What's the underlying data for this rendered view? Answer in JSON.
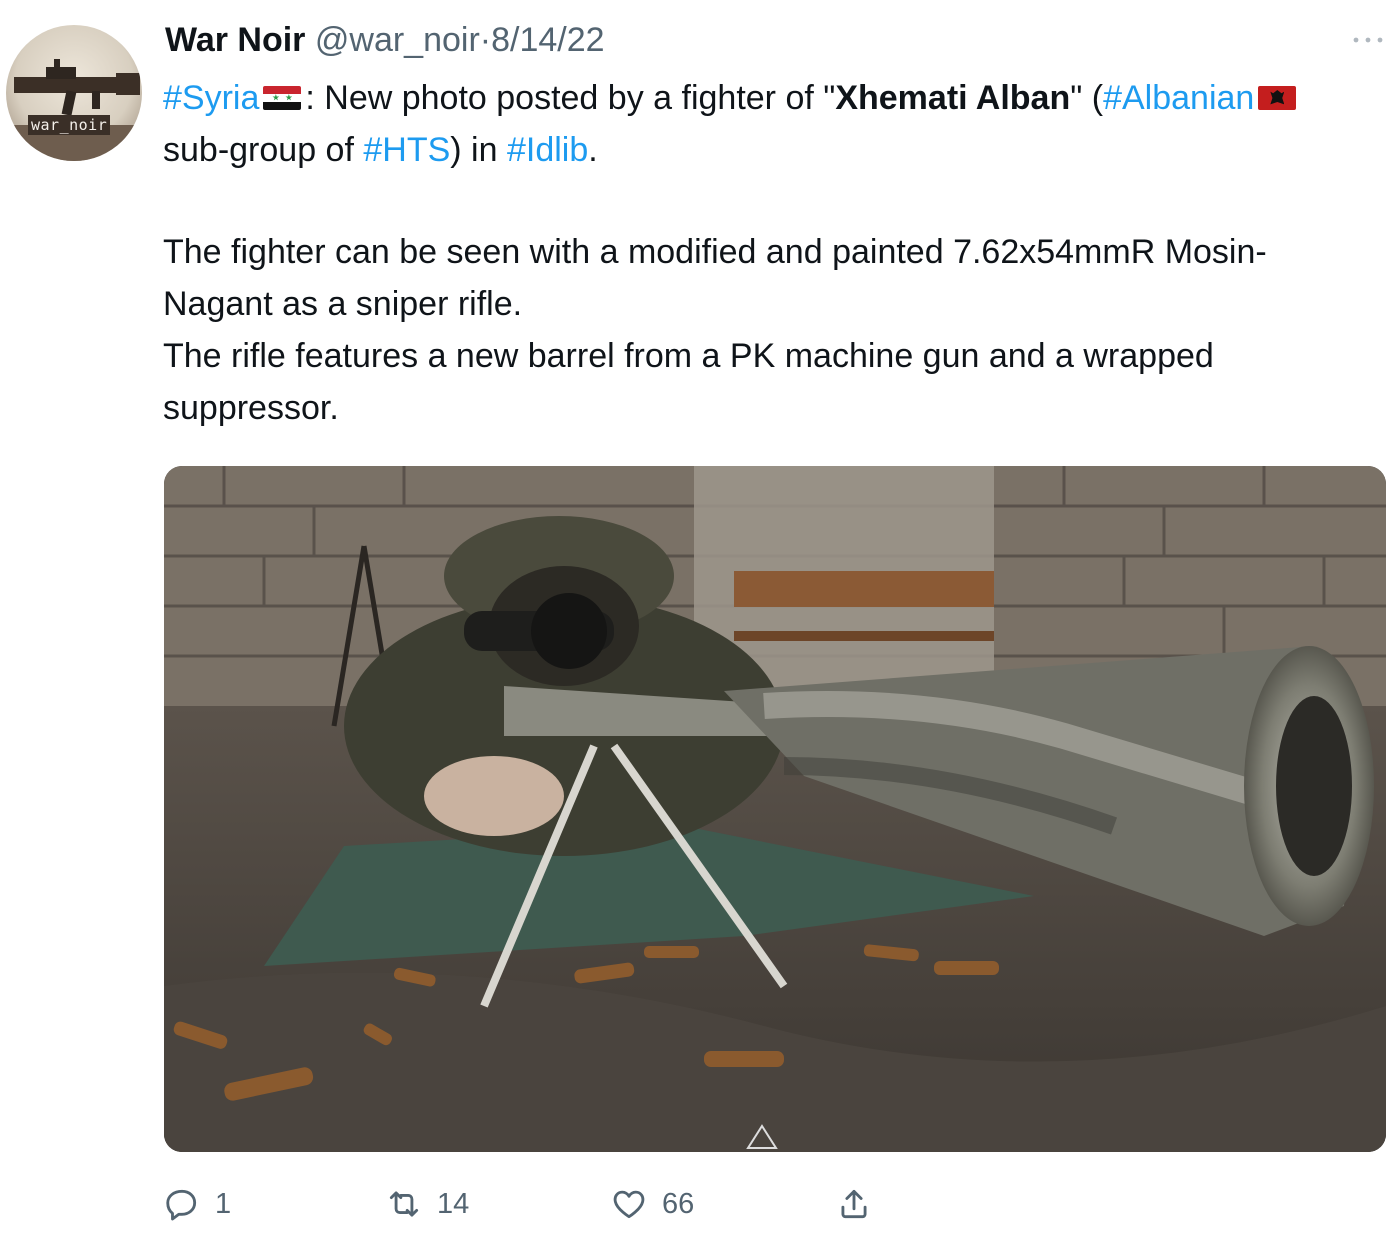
{
  "author": {
    "display_name": "War Noir",
    "handle": "@war_noir",
    "separator": "·",
    "date": "8/14/22",
    "avatar_text": "war_noir"
  },
  "tweet": {
    "line1_tag": "#Syria",
    "line1_text": ": New photo posted by a fighter of \"",
    "group_name_bold": "Xhemati Alban",
    "after_group": "\" (",
    "tag_albanian": "#Albanian",
    "mid_text": " sub-group of ",
    "tag_hts": "#HTS",
    "close_in": ") in ",
    "tag_idlib": "#Idlib",
    "end": ".",
    "para2_line1": "The fighter can be seen with a modified and painted 7.62x54mmR Mosin-Nagant as a sniper rifle.",
    "para3": "The rifle features a new barrel from a PK machine gun and a wrapped suppressor."
  },
  "actions": {
    "reply_count": "1",
    "retweet_count": "14",
    "like_count": "66"
  },
  "icons": {
    "more": "more-icon",
    "reply": "reply-icon",
    "retweet": "retweet-icon",
    "like": "heart-icon",
    "share": "share-icon"
  },
  "colors": {
    "link": "#1d9bf0",
    "secondary_text": "#536471",
    "primary_text": "#0f1419"
  }
}
